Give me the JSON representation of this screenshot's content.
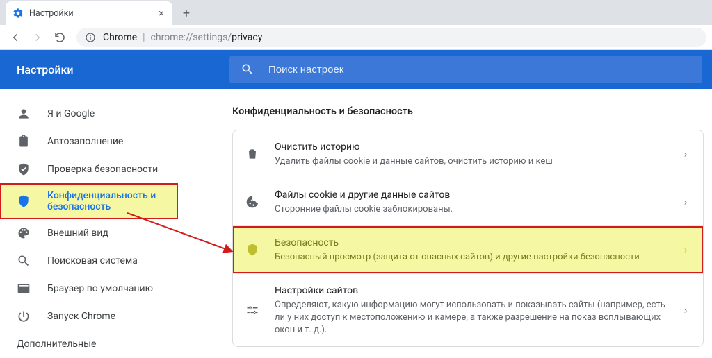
{
  "browser": {
    "tab_title": "Настройки",
    "omnibox": {
      "label": "Chrome",
      "scheme": "chrome://",
      "path_prefix": "settings/",
      "path_bold": "privacy"
    }
  },
  "appbar": {
    "title": "Настройки",
    "search_placeholder": "Поиск настроек"
  },
  "sidebar": {
    "items": [
      {
        "label": "Я и Google"
      },
      {
        "label": "Автозаполнение"
      },
      {
        "label": "Проверка безопасности"
      },
      {
        "label": "Конфиденциальность и безопасность"
      },
      {
        "label": "Внешний вид"
      },
      {
        "label": "Поисковая система"
      },
      {
        "label": "Браузер по умолчанию"
      },
      {
        "label": "Запуск Chrome"
      }
    ],
    "more_label": "Дополнительные"
  },
  "section": {
    "title": "Конфиденциальность и безопасность",
    "rows": [
      {
        "title": "Очистить историю",
        "subtitle": "Удалить файлы cookie и данные сайтов, очистить историю и кеш"
      },
      {
        "title": "Файлы cookie и другие данные сайтов",
        "subtitle": "Сторонние файлы cookie заблокированы."
      },
      {
        "title": "Безопасность",
        "subtitle": "Безопасный просмотр (защита от опасных сайтов) и другие настройки безопасности"
      },
      {
        "title": "Настройки сайтов",
        "subtitle": "Определяют, какую информацию могут использовать и показывать сайты (например, есть ли у них доступ к местоположению и камере, а также разрешение на показ всплывающих окон и т. д.)."
      }
    ]
  }
}
